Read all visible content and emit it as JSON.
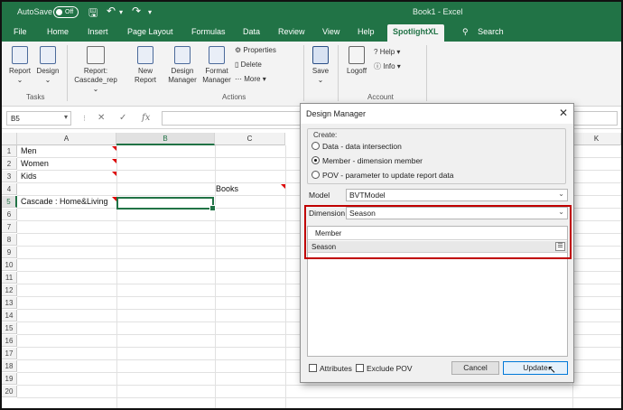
{
  "titlebar": {
    "autosave_label": "AutoSave",
    "autosave_state": "Off",
    "document_title": "Book1 - Excel"
  },
  "tabs": [
    "File",
    "Home",
    "Insert",
    "Page Layout",
    "Formulas",
    "Data",
    "Review",
    "View",
    "Help",
    "SpotlightXL"
  ],
  "active_tab": "SpotlightXL",
  "search_label": "Search",
  "ribbon": {
    "report": "Report",
    "design": "Design",
    "tasks_group": "Tasks",
    "report_cascade": "Report:",
    "report_cascade_2": "Cascade_rep",
    "new_report": "New",
    "new_report_2": "Report",
    "design_manager": "Design",
    "design_manager_2": "Manager",
    "format_manager": "Format",
    "format_manager_2": "Manager",
    "properties": "Properties",
    "delete": "Delete",
    "more": "More",
    "actions_group": "Actions",
    "save": "Save",
    "logoff": "Logoff",
    "help": "Help",
    "info": "Info",
    "account_group": "Account"
  },
  "formula_bar": {
    "name_box": "B5",
    "fx": "fx"
  },
  "columns": [
    "A",
    "B",
    "C",
    "K"
  ],
  "rows": [
    "1",
    "2",
    "3",
    "4",
    "5",
    "6",
    "7",
    "8",
    "9",
    "10",
    "11",
    "12",
    "13",
    "14",
    "15",
    "16",
    "17",
    "18",
    "19",
    "20"
  ],
  "cells": {
    "a1": "Men",
    "a2": "Women",
    "a3": "Kids",
    "c4": "Books",
    "a5": "Cascade : Home&Living"
  },
  "dialog": {
    "title": "Design Manager",
    "create_label": "Create:",
    "options": [
      "Data - data intersection",
      "Member - dimension member",
      "POV - parameter to update report data"
    ],
    "selected_option": "Member - dimension member",
    "model_label": "Model",
    "model_value": "BVTModel",
    "dimension_label": "Dimension",
    "dimension_value": "Season",
    "member_header": "Member",
    "member_value": "Season",
    "attributes_label": "Attributes",
    "exclude_pov_label": "Exclude POV",
    "cancel_label": "Cancel",
    "update_label": "Update"
  },
  "colors": {
    "excel_green": "#217346",
    "highlight_red": "#c00000"
  }
}
